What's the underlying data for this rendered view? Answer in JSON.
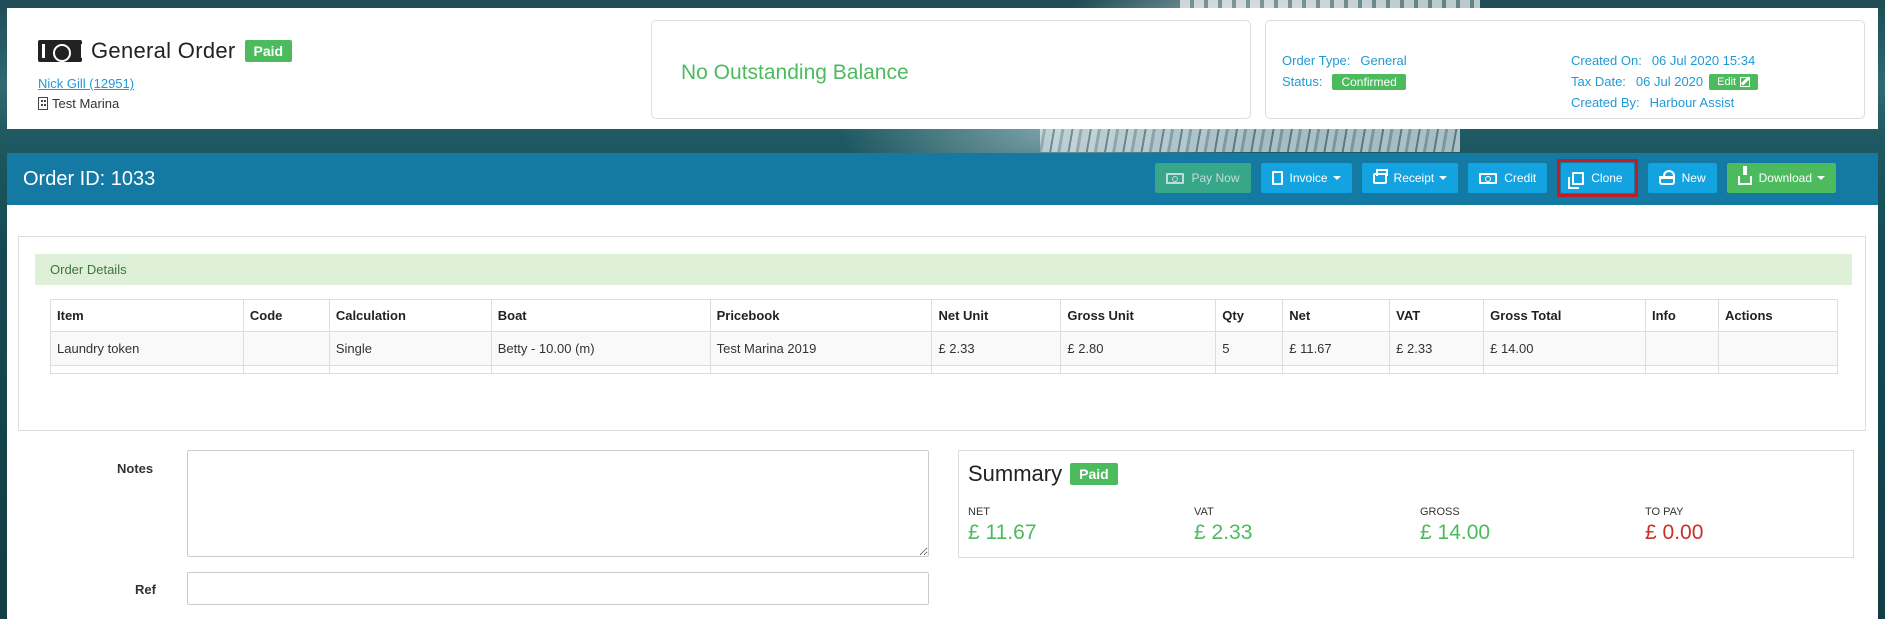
{
  "header": {
    "order_title": "General Order",
    "paid_badge": "Paid",
    "customer_link": "Nick Gill (12951)",
    "marina": "Test Marina",
    "balance_text": "No Outstanding Balance",
    "meta": {
      "order_type_label": "Order Type:",
      "order_type_value": "General",
      "status_label": "Status:",
      "status_value": "Confirmed",
      "created_on_label": "Created On:",
      "created_on_value": "06 Jul 2020 15:34",
      "tax_date_label": "Tax Date:",
      "tax_date_value": "06 Jul 2020",
      "edit_label": "Edit",
      "created_by_label": "Created By:",
      "created_by_value": "Harbour Assist"
    }
  },
  "order_bar": {
    "order_id": "Order ID: 1033",
    "buttons": {
      "pay_now": "Pay Now",
      "invoice": "Invoice",
      "receipt": "Receipt",
      "credit": "Credit",
      "clone": "Clone",
      "new": "New",
      "download": "Download"
    }
  },
  "details": {
    "title": "Order Details",
    "columns": [
      "Item",
      "Code",
      "Calculation",
      "Boat",
      "Pricebook",
      "Net Unit",
      "Gross Unit",
      "Qty",
      "Net",
      "VAT",
      "Gross Total",
      "Info",
      "Actions"
    ],
    "rows": [
      [
        "Laundry token",
        "",
        "Single",
        "Betty - 10.00 (m)",
        "Test Marina 2019",
        "£ 2.33",
        "£ 2.80",
        "5",
        "£ 11.67",
        "£ 2.33",
        "£ 14.00",
        "",
        ""
      ]
    ]
  },
  "form": {
    "notes_label": "Notes",
    "notes_value": "",
    "ref_label": "Ref",
    "ref_value": ""
  },
  "summary": {
    "title": "Summary",
    "badge": "Paid",
    "net_label": "NET",
    "net_value": "£ 11.67",
    "vat_label": "VAT",
    "vat_value": "£ 2.33",
    "gross_label": "GROSS",
    "gross_value": "£ 14.00",
    "to_pay_label": "TO PAY",
    "to_pay_value": "£ 0.00"
  },
  "colors": {
    "accent_blue": "#1479a3",
    "button_blue": "#13a3e1",
    "green": "#4cbb5e",
    "red": "#c9302c",
    "highlight": "#c91a22"
  }
}
